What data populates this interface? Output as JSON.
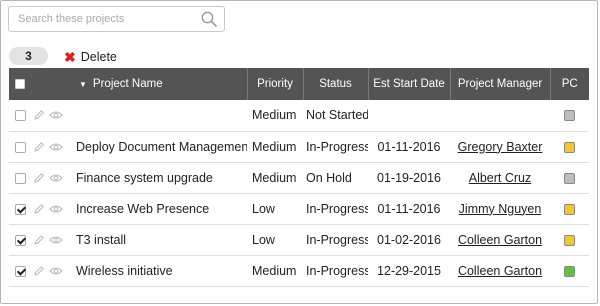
{
  "search": {
    "placeholder": "Search these projects",
    "value": ""
  },
  "toolbar": {
    "selected_count": "3",
    "delete_label": "Delete"
  },
  "colors": {
    "header_bg": "#545454",
    "pc_gray": "#bdbdbd",
    "pc_yellow": "#f3c732",
    "pc_green": "#5fc23b",
    "delete_x": "#e02020"
  },
  "table": {
    "headers": {
      "name": "Project Name",
      "priority": "Priority",
      "status": "Status",
      "start": "Est Start Date",
      "manager": "Project Manager",
      "pc": "PC"
    },
    "rows": [
      {
        "checked": false,
        "name": "",
        "priority": "Medium",
        "status": "Not Started",
        "start": "",
        "manager": "",
        "pc": "gray"
      },
      {
        "checked": false,
        "name": "Deploy Document Management",
        "priority": "Medium",
        "status": "In-Progress",
        "start": "01-11-2016",
        "manager": "Gregory Baxter",
        "pc": "yellow"
      },
      {
        "checked": false,
        "name": "Finance system upgrade",
        "priority": "Medium",
        "status": "On Hold",
        "start": "01-19-2016",
        "manager": "Albert Cruz",
        "pc": "gray"
      },
      {
        "checked": true,
        "name": "Increase Web Presence",
        "priority": "Low",
        "status": "In-Progress",
        "start": "01-11-2016",
        "manager": "Jimmy Nguyen",
        "pc": "yellow"
      },
      {
        "checked": true,
        "name": "T3 install",
        "priority": "Low",
        "status": "In-Progress",
        "start": "01-02-2016",
        "manager": "Colleen Garton",
        "pc": "yellow"
      },
      {
        "checked": true,
        "name": "Wireless initiative",
        "priority": "Medium",
        "status": "In-Progress",
        "start": "12-29-2015",
        "manager": "Colleen Garton",
        "pc": "green"
      }
    ]
  }
}
